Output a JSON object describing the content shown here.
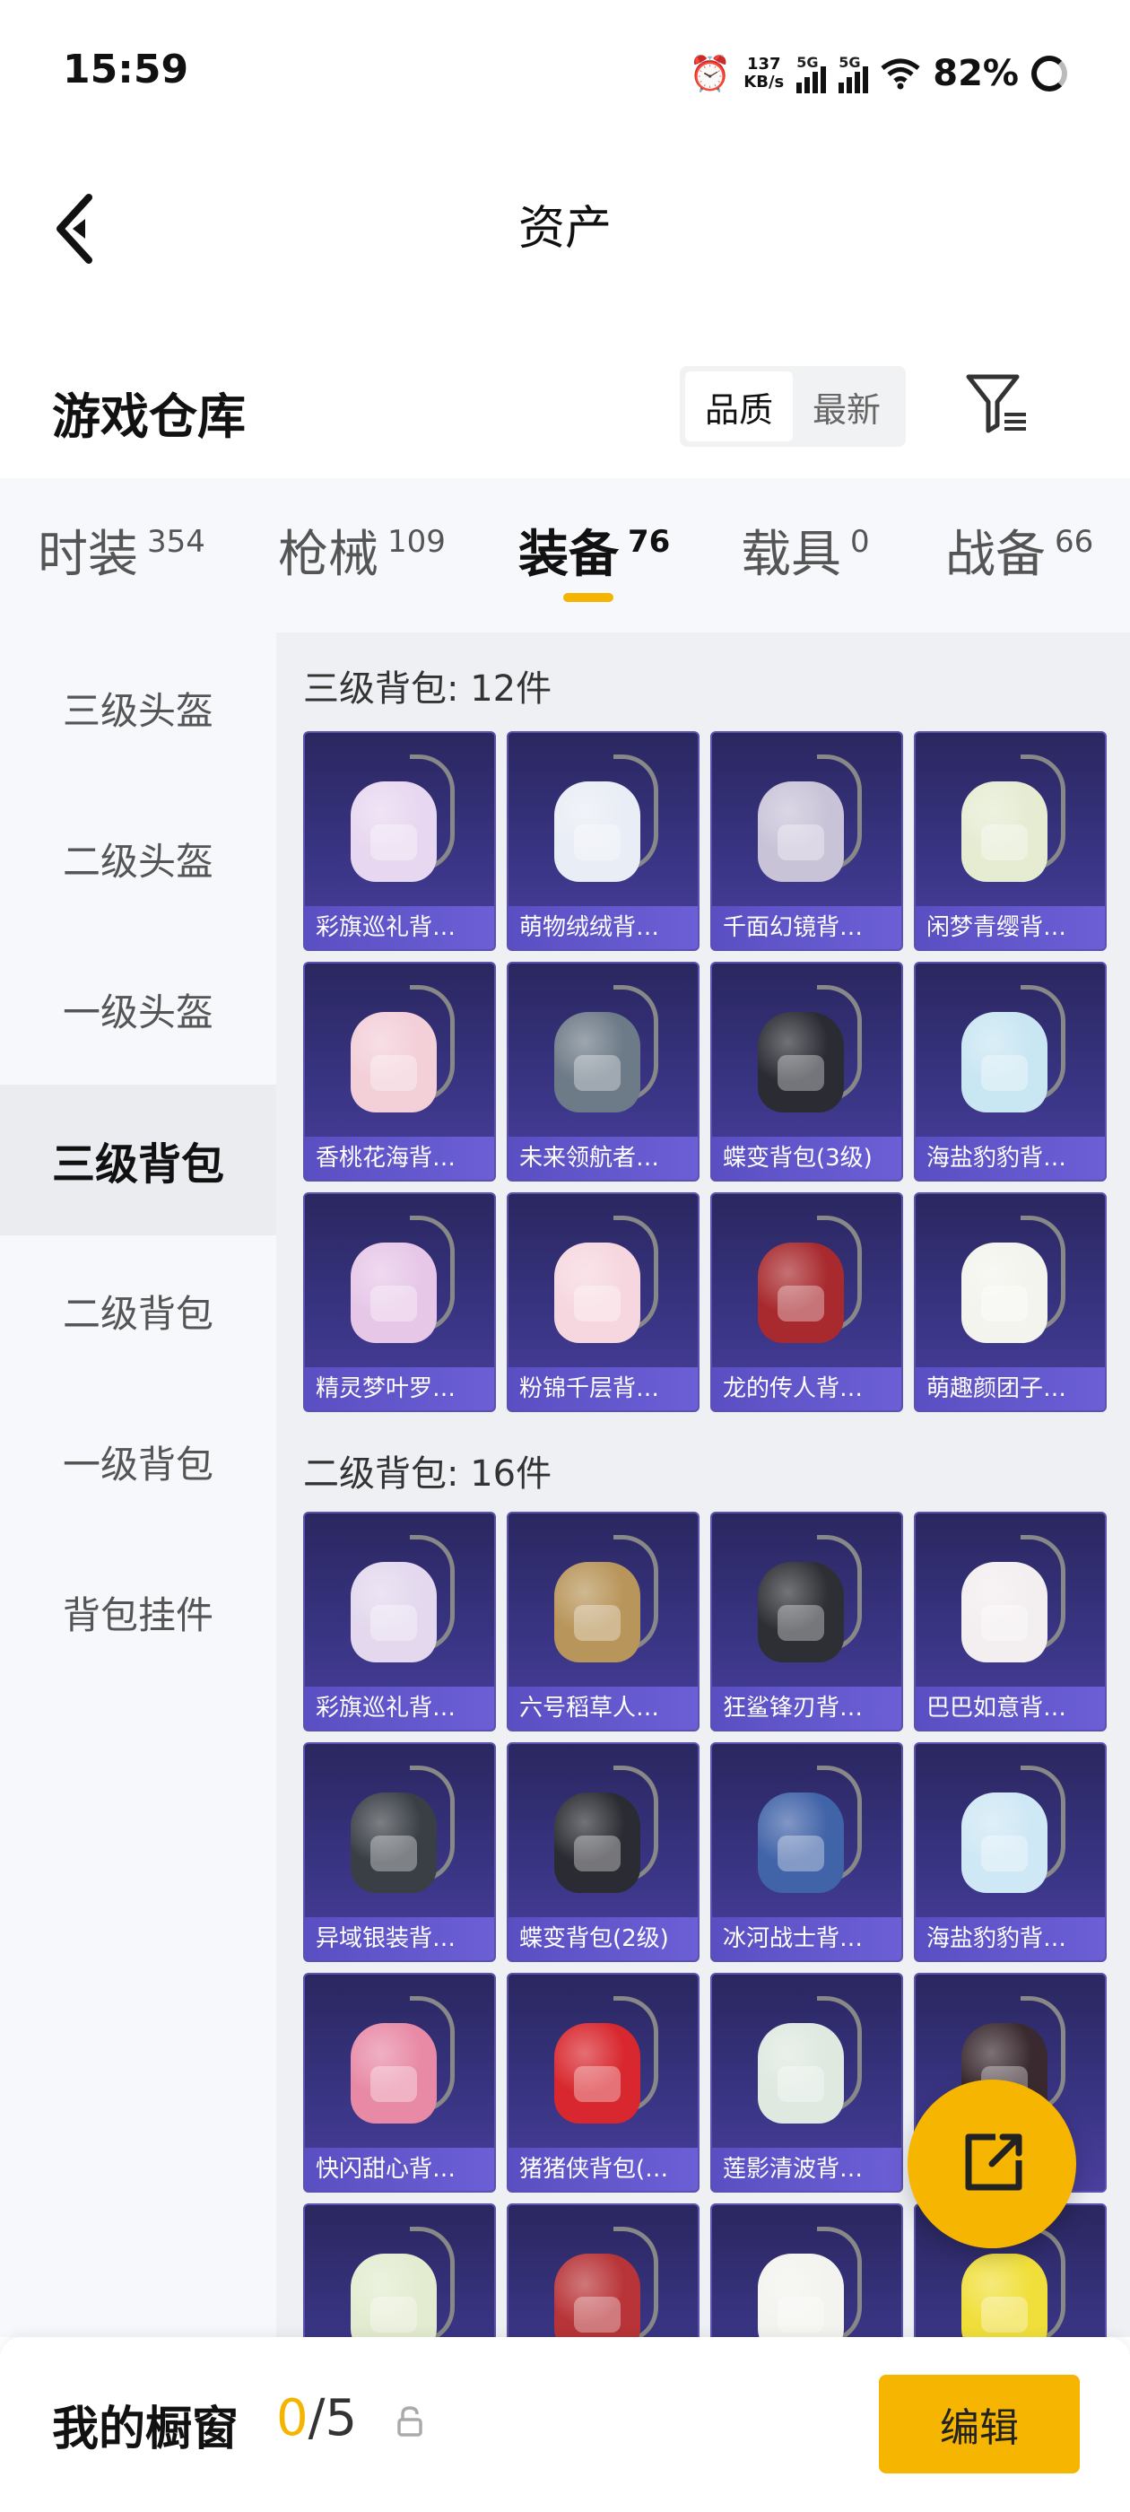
{
  "status_bar": {
    "time": "15:59",
    "net_speed_value": "137",
    "net_speed_unit": "KB/s",
    "sim1": "5G",
    "sim2": "5G",
    "battery": "82%"
  },
  "header": {
    "title": "资产"
  },
  "section": {
    "title": "游戏仓库",
    "sort_options": [
      "品质",
      "最新"
    ],
    "sort_selected": "品质"
  },
  "tabs": [
    {
      "label": "时装",
      "count": "354"
    },
    {
      "label": "枪械",
      "count": "109"
    },
    {
      "label": "装备",
      "count": "76"
    },
    {
      "label": "载具",
      "count": "0"
    },
    {
      "label": "战备",
      "count": "66"
    }
  ],
  "active_tab": "装备",
  "sidebar": {
    "items": [
      "三级头盔",
      "二级头盔",
      "一级头盔",
      "三级背包",
      "二级背包",
      "一级背包",
      "背包挂件"
    ],
    "active": "三级背包"
  },
  "groups": [
    {
      "title": "三级背包: 12件",
      "items": [
        {
          "name": "彩旗巡礼背…",
          "color": "#e8d7f0"
        },
        {
          "name": "萌物绒绒背…",
          "color": "#e9edf5"
        },
        {
          "name": "千面幻镜背…",
          "color": "#c9c3d8"
        },
        {
          "name": "闲梦青缨背…",
          "color": "#e5ecd2"
        },
        {
          "name": "香桃花海背…",
          "color": "#f3cfd8"
        },
        {
          "name": "未来领航者…",
          "color": "#6d7a87"
        },
        {
          "name": "蝶变背包(3级)",
          "color": "#2a2b33"
        },
        {
          "name": "海盐豹豹背…",
          "color": "#c9e6f3"
        },
        {
          "name": "精灵梦叶罗…",
          "color": "#e7c7e8"
        },
        {
          "name": "粉锦千层背…",
          "color": "#f6d7df"
        },
        {
          "name": "龙的传人背…",
          "color": "#a82a2e"
        },
        {
          "name": "萌趣颜团子…",
          "color": "#f4f4ee"
        }
      ]
    },
    {
      "title": "二级背包: 16件",
      "items": [
        {
          "name": "彩旗巡礼背…",
          "color": "#e3d8ee"
        },
        {
          "name": "六号稻草人…",
          "color": "#b8955a"
        },
        {
          "name": "狂鲨锋刃背…",
          "color": "#2d2f34"
        },
        {
          "name": "巴巴如意背…",
          "color": "#f3eef0"
        },
        {
          "name": "异域银装背…",
          "color": "#3a3f46"
        },
        {
          "name": "蝶变背包(2级)",
          "color": "#2b2c33"
        },
        {
          "name": "冰河战士背…",
          "color": "#4163a8"
        },
        {
          "name": "海盐豹豹背…",
          "color": "#cfe8f5"
        },
        {
          "name": "快闪甜心背…",
          "color": "#e88aa6"
        },
        {
          "name": "猪猪侠背包(…",
          "color": "#d8272e"
        },
        {
          "name": "莲影清波背…",
          "color": "#dfe9e0"
        },
        {
          "name": "",
          "color": "#3a2a2f"
        },
        {
          "name": "",
          "color": "#e3ecd0"
        },
        {
          "name": "",
          "color": "#b83438"
        },
        {
          "name": "",
          "color": "#f3f3ef"
        },
        {
          "name": "",
          "color": "#f0df3a"
        }
      ]
    }
  ],
  "showcase": {
    "label": "我的橱窗",
    "current": "0",
    "total": "/5"
  },
  "edit_label": "编辑",
  "icons": {
    "back": "back-icon",
    "filter": "filter-icon",
    "share": "share-icon",
    "lock": "lock-icon"
  },
  "colors": {
    "accent": "#f6b500",
    "card_bg": "#3a3585",
    "card_label": "#6c5fd6"
  }
}
